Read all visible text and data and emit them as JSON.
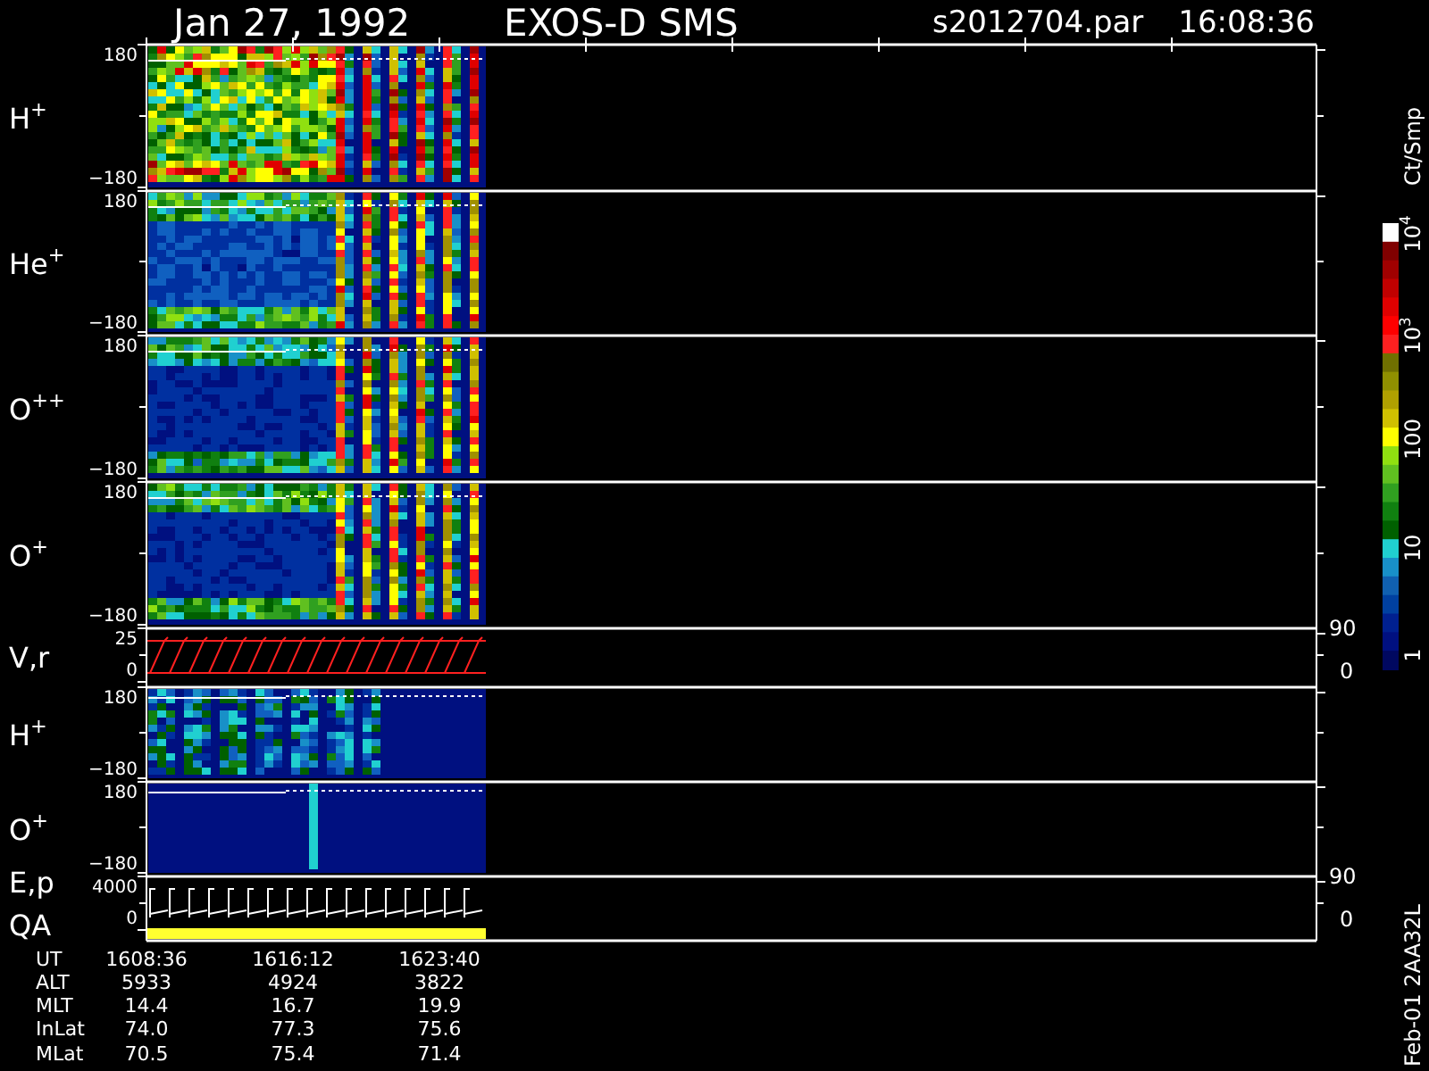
{
  "header": {
    "date": "Jan 27, 1992",
    "instrument": "EXOS-D SMS",
    "file": "s2012704.par",
    "time": "16:08:36"
  },
  "panels": [
    {
      "kind": "spectrogram",
      "labels": [
        {
          "text": "H",
          "sup": "+"
        }
      ],
      "left_ticks": [
        "180",
        "−180"
      ]
    },
    {
      "kind": "spectrogram",
      "labels": [
        {
          "text": "He",
          "sup": "+"
        }
      ],
      "left_ticks": [
        "180",
        "−180"
      ]
    },
    {
      "kind": "spectrogram",
      "labels": [
        {
          "text": "O",
          "sup": "++"
        }
      ],
      "left_ticks": [
        "180",
        "−180"
      ]
    },
    {
      "kind": "spectrogram",
      "labels": [
        {
          "text": "O",
          "sup": "+"
        }
      ],
      "left_ticks": [
        "180",
        "−180"
      ]
    },
    {
      "kind": "velocity",
      "labels": [
        {
          "text": "V,r"
        }
      ],
      "left_ticks": [
        "25",
        "0"
      ],
      "right_ticks": [
        "90",
        "0"
      ]
    },
    {
      "kind": "spectrogram",
      "labels": [
        {
          "text": "H",
          "sup": "+"
        }
      ],
      "left_ticks": [
        "180",
        "−180"
      ]
    },
    {
      "kind": "spectrogram",
      "labels": [
        {
          "text": "O",
          "sup": "+"
        }
      ],
      "left_ticks": [
        "180",
        "−180"
      ]
    },
    {
      "kind": "energy",
      "labels": [
        {
          "text": "E,p"
        },
        {
          "text": "QA"
        }
      ],
      "left_ticks": [
        "4000",
        "0"
      ],
      "right_ticks": [
        "90",
        "0"
      ]
    }
  ],
  "colorbar": {
    "unit": "Ct/Smp",
    "labels": [
      {
        "text": "10",
        "sup": "4"
      },
      {
        "text": "10",
        "sup": "3"
      },
      {
        "text": "100"
      },
      {
        "text": "10"
      },
      {
        "text": "1"
      }
    ]
  },
  "orbit_table": [
    {
      "label": "UT",
      "values": [
        "1608:36",
        "1616:12",
        "1623:40"
      ]
    },
    {
      "label": "ALT",
      "values": [
        "5933",
        "4924",
        "3822"
      ]
    },
    {
      "label": "MLT",
      "values": [
        "14.4",
        "16.7",
        "19.9"
      ]
    },
    {
      "label": "InLat",
      "values": [
        "74.0",
        "77.3",
        "75.6"
      ]
    },
    {
      "label": "MLat",
      "values": [
        "70.5",
        "75.4",
        "71.4"
      ]
    }
  ],
  "footnote": "Feb-01 2AA32L"
}
